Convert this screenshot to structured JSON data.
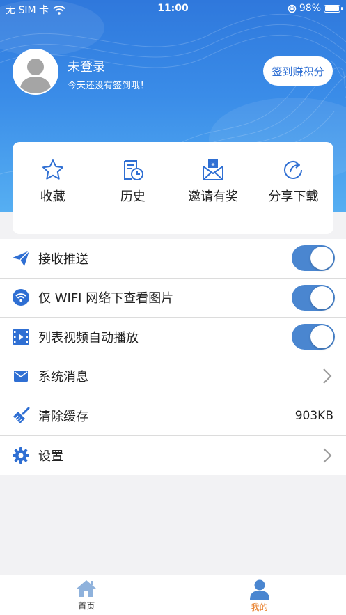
{
  "status_bar": {
    "carrier": "无 SIM 卡",
    "time": "11:00",
    "battery": "98%"
  },
  "profile": {
    "name": "未登录",
    "subtitle": "今天还没有签到哦！",
    "signin_button": "签到赚积分"
  },
  "quick_actions": [
    {
      "label": "收藏",
      "icon": "star-icon"
    },
    {
      "label": "历史",
      "icon": "history-icon"
    },
    {
      "label": "邀请有奖",
      "icon": "invite-reward-icon"
    },
    {
      "label": "分享下载",
      "icon": "share-icon"
    }
  ],
  "settings": [
    {
      "label": "接收推送",
      "icon": "paper-plane-icon",
      "control": "toggle",
      "on": true
    },
    {
      "label": "仅 WIFI 网络下查看图片",
      "icon": "wifi-icon",
      "control": "toggle",
      "on": true
    },
    {
      "label": "列表视频自动播放",
      "icon": "video-film-icon",
      "control": "toggle",
      "on": true
    },
    {
      "label": "系统消息",
      "icon": "envelope-icon",
      "control": "chevron"
    },
    {
      "label": "清除缓存",
      "icon": "broom-icon",
      "control": "value",
      "value": "903KB"
    },
    {
      "label": "设置",
      "icon": "gear-icon",
      "control": "chevron"
    }
  ],
  "tab_bar": {
    "home_label": "首页",
    "mine_label": "我的"
  },
  "colors": {
    "accent": "#2f6fd3",
    "toggle_on": "#4a86d0",
    "active_tab": "#e8822f"
  }
}
